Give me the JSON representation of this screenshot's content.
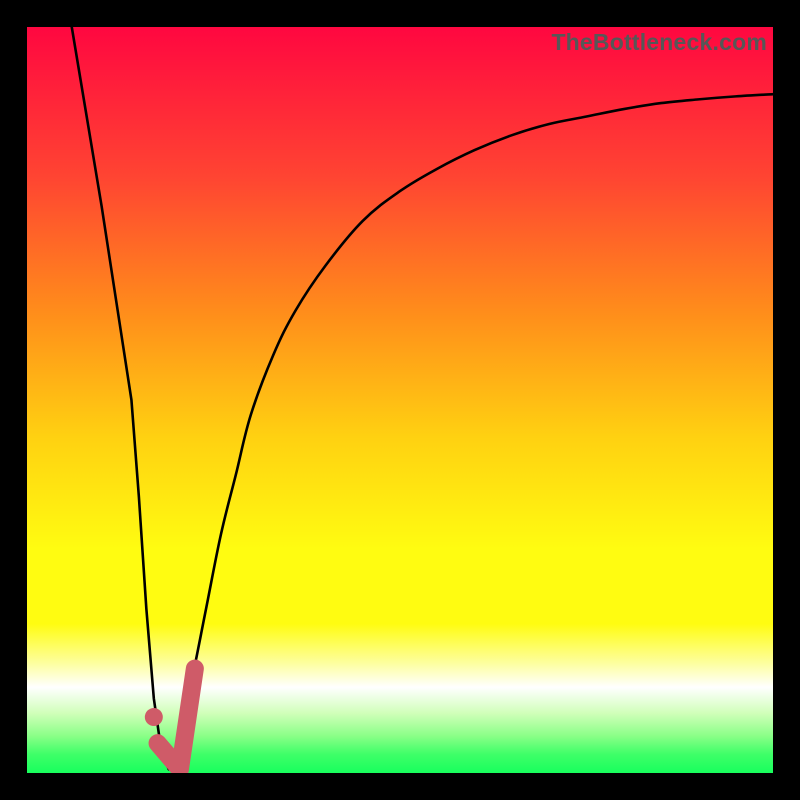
{
  "watermark": "TheBottleneck.com",
  "chart_data": {
    "type": "line",
    "title": "",
    "xlabel": "",
    "ylabel": "",
    "xlim": [
      0,
      100
    ],
    "ylim": [
      0,
      100
    ],
    "grid": false,
    "series": [
      {
        "name": "main-curve",
        "color": "#000000",
        "x": [
          6.0,
          8.0,
          10.0,
          12.0,
          14.0,
          15.0,
          16.0,
          17.0,
          18.0,
          19.0,
          20.0,
          22.0,
          24.0,
          26.0,
          28.0,
          30.0,
          33.0,
          36.0,
          40.0,
          45.0,
          50.0,
          55.0,
          60.0,
          65.0,
          70.0,
          75.0,
          80.0,
          85.0,
          90.0,
          95.0,
          100.0
        ],
        "y": [
          100.0,
          88.0,
          76.0,
          63.0,
          50.0,
          37.0,
          22.0,
          10.0,
          3.0,
          0.5,
          3.0,
          12.0,
          22.0,
          32.0,
          40.0,
          48.0,
          56.0,
          62.0,
          68.0,
          74.0,
          78.0,
          81.0,
          83.5,
          85.5,
          87.0,
          88.0,
          89.0,
          89.8,
          90.3,
          90.7,
          91.0
        ]
      },
      {
        "name": "marker-segment",
        "color": "#cf5b68",
        "style": "thick-rounded",
        "x": [
          17.5,
          20.5,
          22.5
        ],
        "y": [
          4.0,
          0.5,
          14.0
        ]
      },
      {
        "name": "marker-point",
        "color": "#cf5b68",
        "style": "dot",
        "x": [
          17.0
        ],
        "y": [
          7.5
        ]
      }
    ],
    "background_gradient": {
      "type": "vertical",
      "stops": [
        {
          "pos": 0.0,
          "color": "#ff0740"
        },
        {
          "pos": 0.2,
          "color": "#ff4432"
        },
        {
          "pos": 0.38,
          "color": "#ff8c1b"
        },
        {
          "pos": 0.55,
          "color": "#ffd111"
        },
        {
          "pos": 0.7,
          "color": "#fffc11"
        },
        {
          "pos": 0.8,
          "color": "#fffc11"
        },
        {
          "pos": 0.855,
          "color": "#fdffa5"
        },
        {
          "pos": 0.885,
          "color": "#ffffff"
        },
        {
          "pos": 0.92,
          "color": "#d0ffb9"
        },
        {
          "pos": 0.95,
          "color": "#8bff88"
        },
        {
          "pos": 0.975,
          "color": "#3eff68"
        },
        {
          "pos": 1.0,
          "color": "#18ff5d"
        }
      ]
    }
  }
}
